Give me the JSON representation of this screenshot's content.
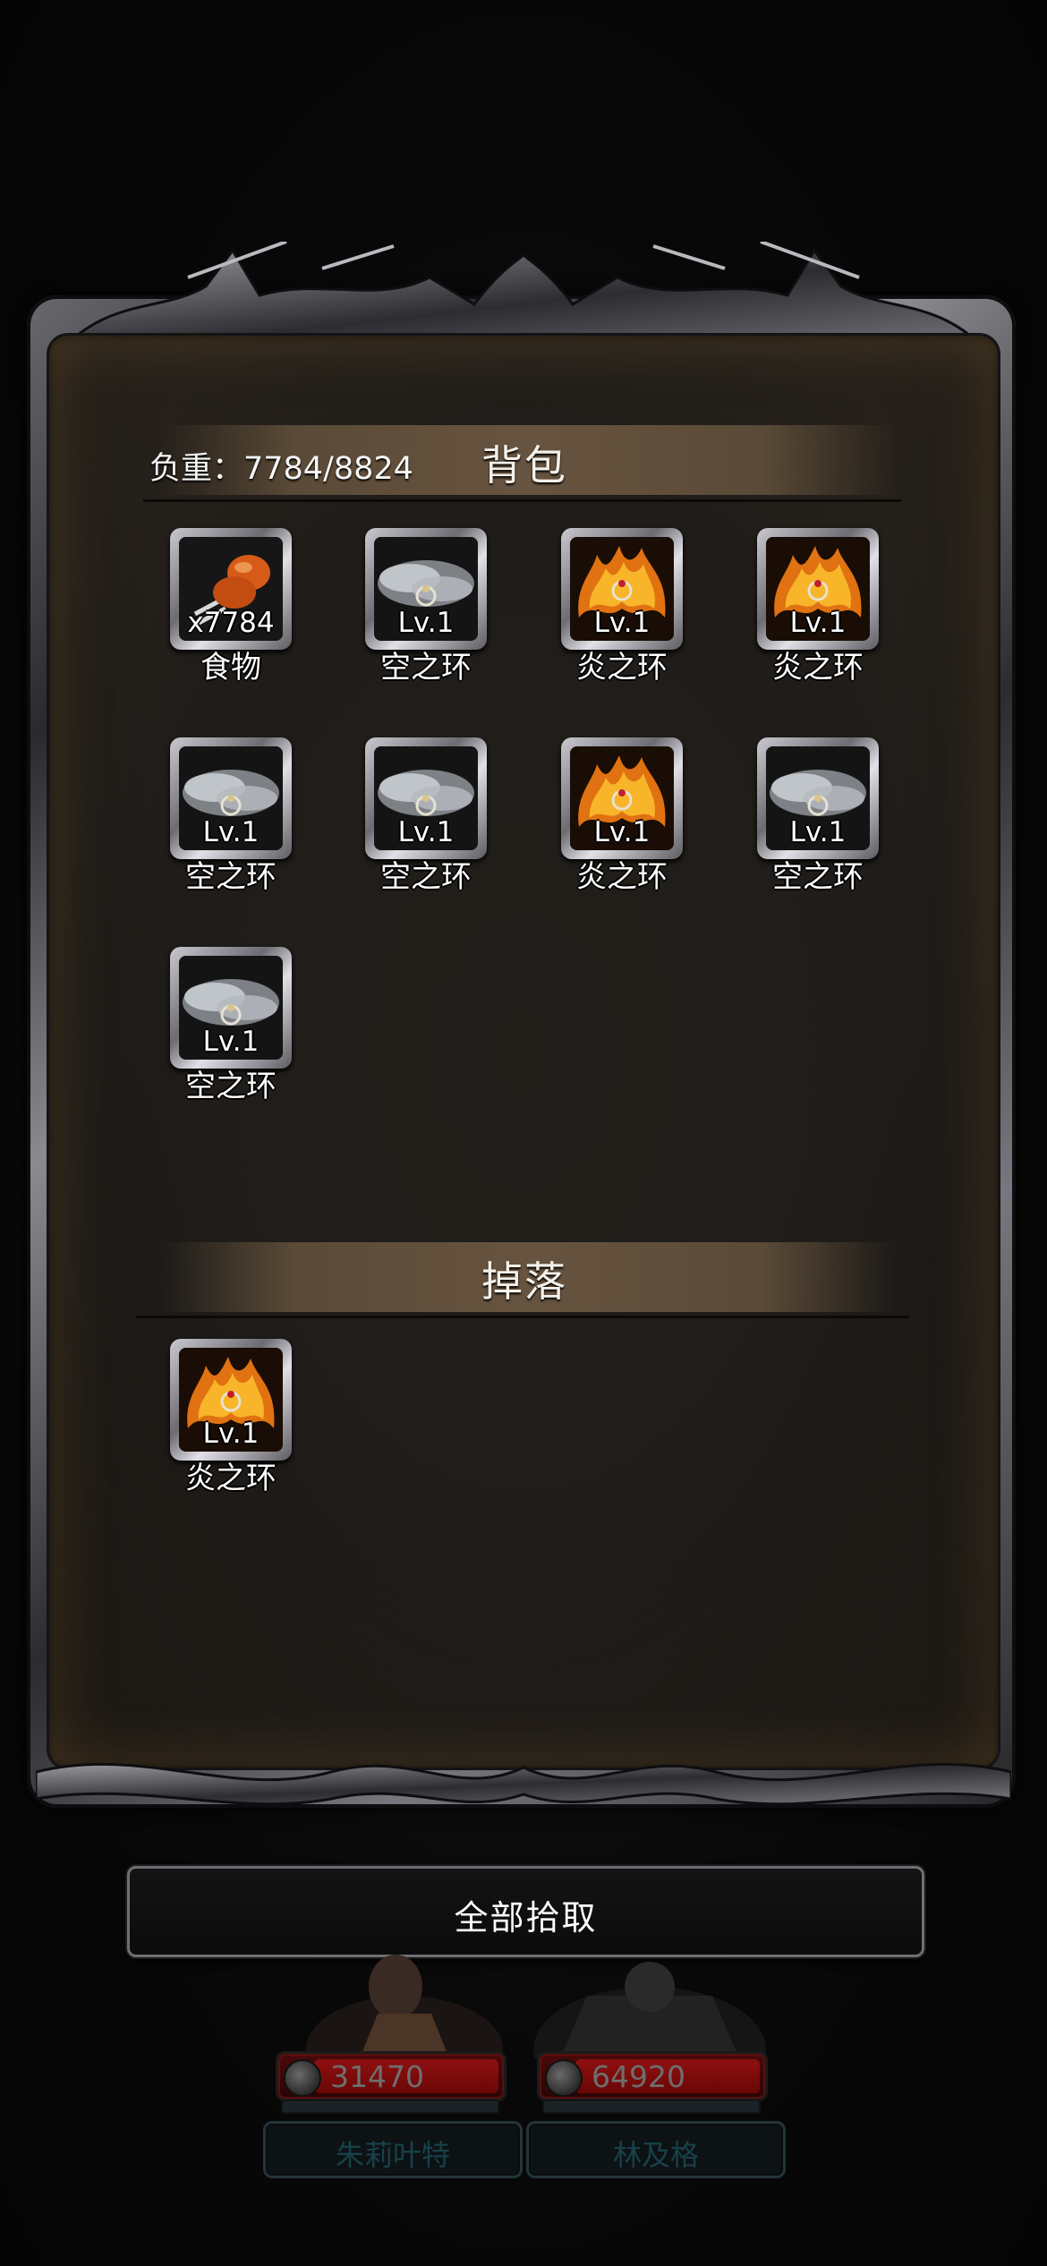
{
  "inventory": {
    "title": "背包",
    "weight_label": "负重：7784/8824",
    "items": [
      {
        "name": "食物",
        "badge": "x7784",
        "icon": "food-meat-icon"
      },
      {
        "name": "空之环",
        "badge": "Lv.1",
        "icon": "sky-ring-icon"
      },
      {
        "name": "炎之环",
        "badge": "Lv.1",
        "icon": "flame-ring-icon"
      },
      {
        "name": "炎之环",
        "badge": "Lv.1",
        "icon": "flame-ring-icon"
      },
      {
        "name": "空之环",
        "badge": "Lv.1",
        "icon": "sky-ring-icon"
      },
      {
        "name": "空之环",
        "badge": "Lv.1",
        "icon": "sky-ring-icon"
      },
      {
        "name": "炎之环",
        "badge": "Lv.1",
        "icon": "flame-ring-icon"
      },
      {
        "name": "空之环",
        "badge": "Lv.1",
        "icon": "sky-ring-icon"
      },
      {
        "name": "空之环",
        "badge": "Lv.1",
        "icon": "sky-ring-icon"
      }
    ]
  },
  "drops": {
    "title": "掉落",
    "items": [
      {
        "name": "炎之环",
        "badge": "Lv.1",
        "icon": "flame-ring-icon"
      }
    ]
  },
  "actions": {
    "pick_all_label": "全部拾取"
  },
  "party": [
    {
      "name": "朱莉叶特",
      "hp": "31470",
      "icon": "sword-icon"
    },
    {
      "name": "林及格",
      "hp": "64920",
      "icon": "sword-icon"
    }
  ],
  "colors": {
    "header_band": "#675440",
    "hp_bar": "#8f1010",
    "name_plate_text": "#17414a"
  }
}
